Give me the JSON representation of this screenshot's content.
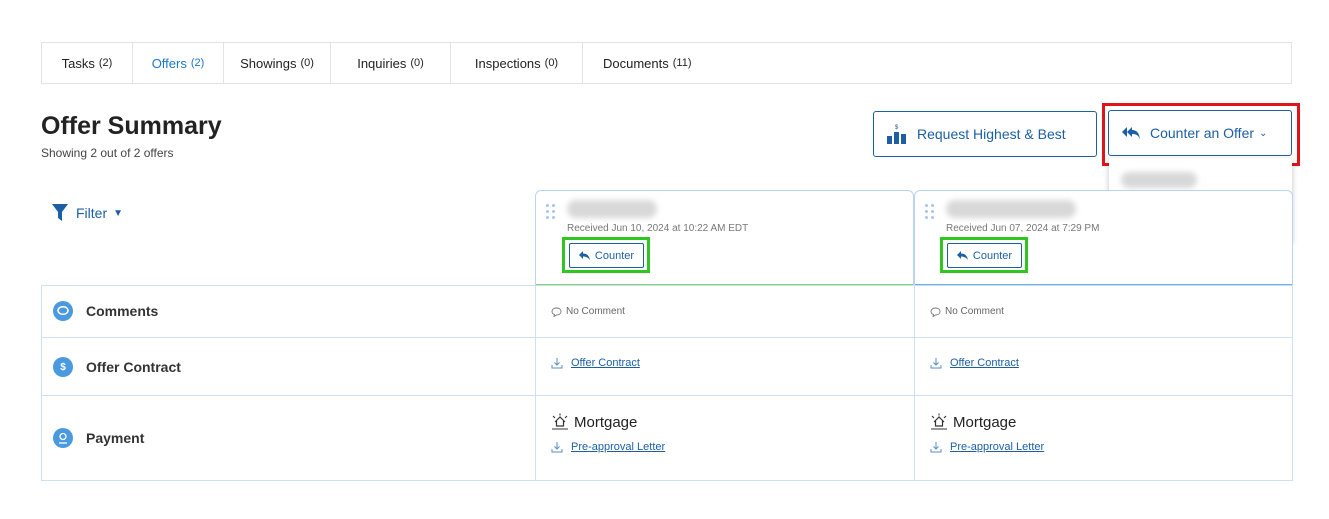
{
  "tabs": [
    {
      "label": "Tasks",
      "count": "(2)"
    },
    {
      "label": "Offers",
      "count": "(2)"
    },
    {
      "label": "Showings",
      "count": "(0)"
    },
    {
      "label": "Inquiries",
      "count": "(0)"
    },
    {
      "label": "Inspections",
      "count": "(0)"
    },
    {
      "label": "Documents",
      "count": "(11)"
    }
  ],
  "active_tab": "Offers",
  "summary": {
    "title": "Offer Summary",
    "subtitle": "Showing 2 out of 2 offers"
  },
  "actions": {
    "request_highest_best": "Request Highest & Best",
    "counter_an_offer": "Counter an Offer"
  },
  "filter": {
    "label": "Filter"
  },
  "offers": [
    {
      "received": "Received Jun 10, 2024 at 10:22 AM EDT",
      "counter_label": "Counter",
      "comment": "No Comment",
      "contract_link": "Offer Contract",
      "payment_type": "Mortgage",
      "preapproval_link": "Pre-approval Letter"
    },
    {
      "received": "Received Jun 07, 2024 at 7:29 PM",
      "counter_label": "Counter",
      "comment": "No Comment",
      "contract_link": "Offer Contract",
      "payment_type": "Mortgage",
      "preapproval_link": "Pre-approval Letter"
    }
  ],
  "rows": {
    "comments": "Comments",
    "offer_contract": "Offer Contract",
    "payment": "Payment"
  },
  "colors": {
    "accent": "#1d5fa3",
    "highlight_red": "#e0141b",
    "highlight_green": "#2fc71f",
    "icon_blue": "#4b9ae0"
  }
}
